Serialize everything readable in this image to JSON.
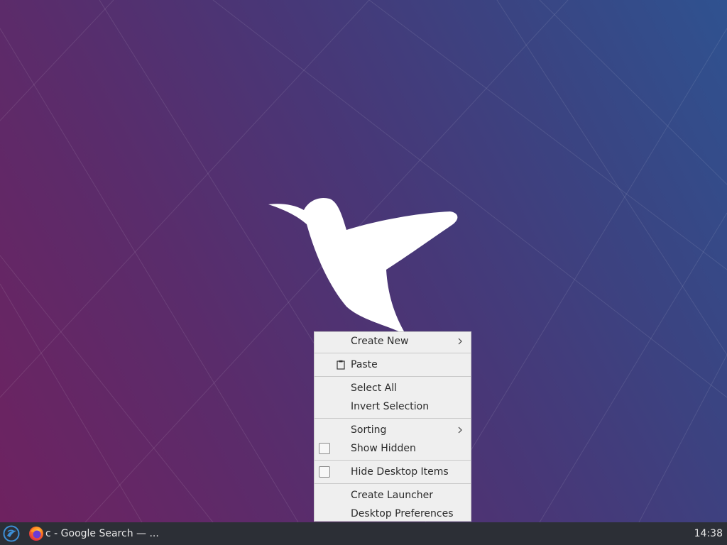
{
  "context_menu": {
    "items": [
      {
        "label": "Create New",
        "submenu": true
      },
      {
        "label": "Paste",
        "icon": "clipboard-icon"
      },
      {
        "label": "Select All"
      },
      {
        "label": "Invert Selection"
      },
      {
        "label": "Sorting",
        "submenu": true
      },
      {
        "label": "Show Hidden",
        "checkbox": true,
        "checked": false
      },
      {
        "label": "Hide Desktop Items",
        "checkbox": true,
        "checked": false
      },
      {
        "label": "Create Launcher"
      },
      {
        "label": "Desktop Preferences"
      }
    ]
  },
  "taskbar": {
    "start_icon": "lubuntu-logo-icon",
    "tasks": [
      {
        "label": "c - Google Search — ...",
        "icon": "firefox-icon"
      }
    ],
    "clock": "14:38"
  },
  "colors": {
    "taskbar_bg": "#2c2f36",
    "menu_bg": "#efefef",
    "wallpaper_left": "#6e2260",
    "wallpaper_right": "#2f5290"
  }
}
